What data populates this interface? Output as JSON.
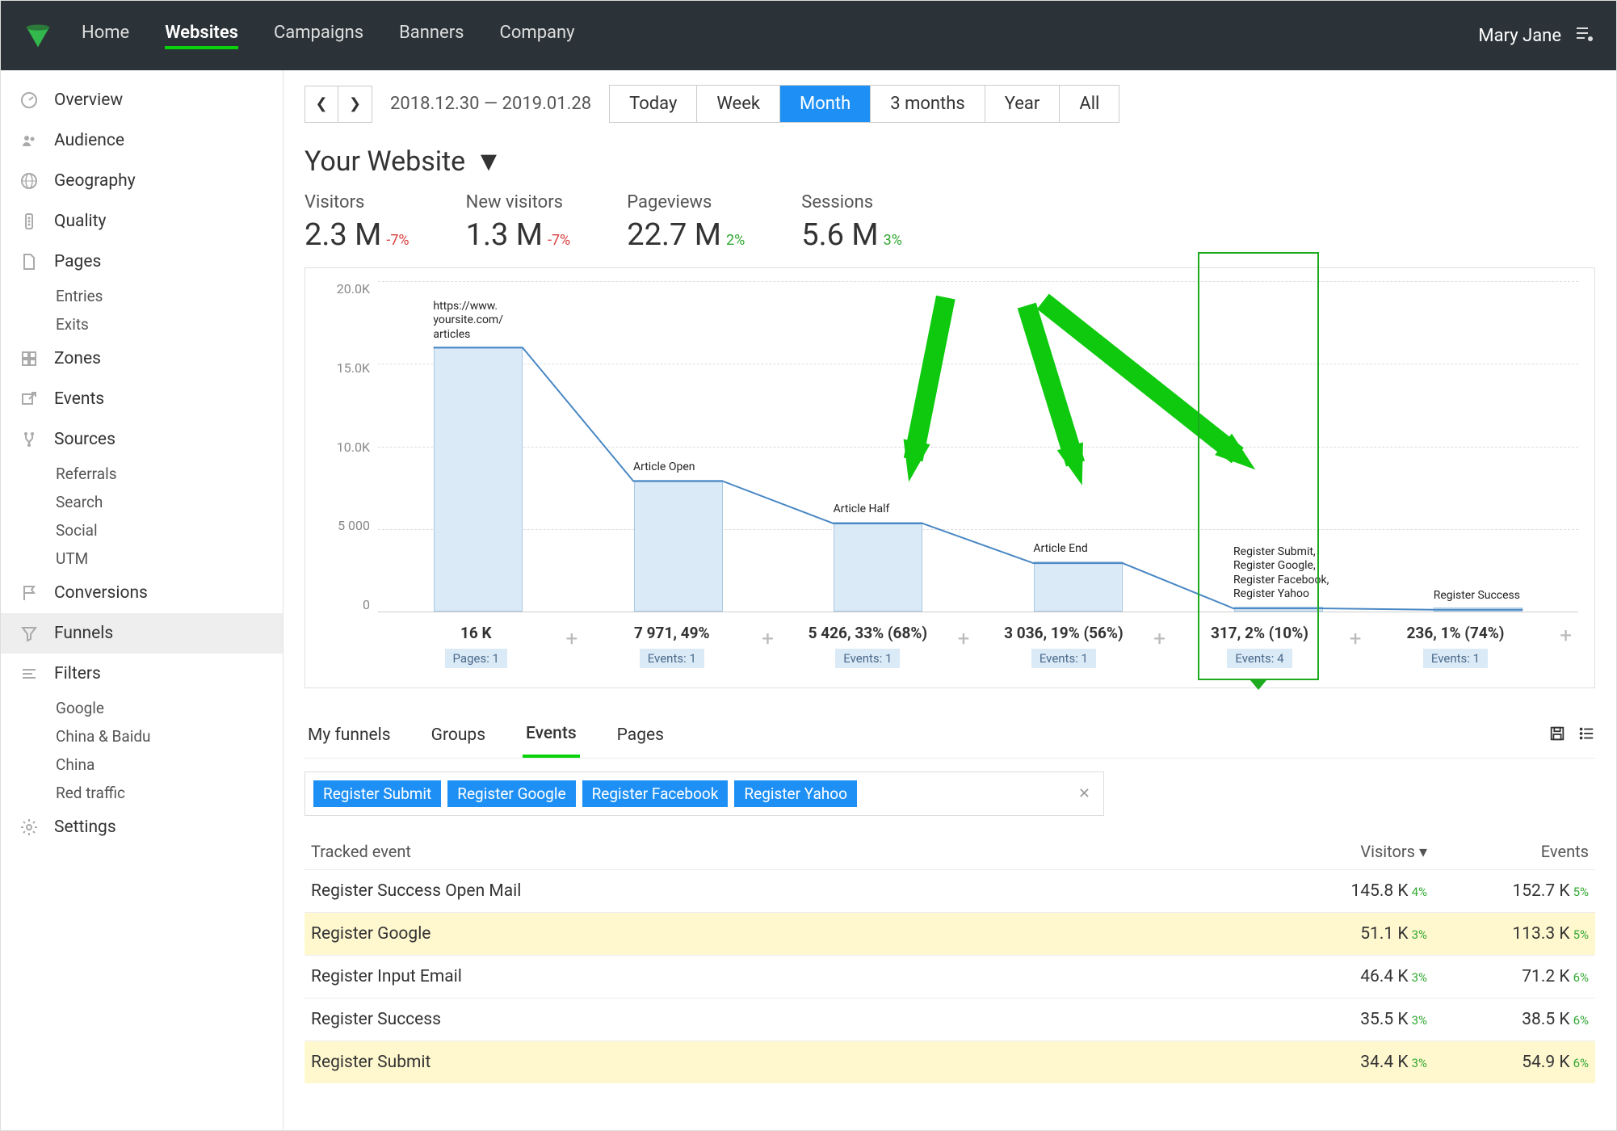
{
  "user_name": "Mary Jane",
  "topnav": [
    "Home",
    "Websites",
    "Campaigns",
    "Banners",
    "Company"
  ],
  "topnav_active": 1,
  "sidebar": [
    {
      "label": "Overview",
      "icon": "gauge"
    },
    {
      "label": "Audience",
      "icon": "people"
    },
    {
      "label": "Geography",
      "icon": "globe"
    },
    {
      "label": "Quality",
      "icon": "traffic"
    },
    {
      "label": "Pages",
      "icon": "file",
      "subs": [
        "Entries",
        "Exits"
      ]
    },
    {
      "label": "Zones",
      "icon": "grid"
    },
    {
      "label": "Events",
      "icon": "arrow-out"
    },
    {
      "label": "Sources",
      "icon": "branch",
      "subs": [
        "Referrals",
        "Search",
        "Social",
        "UTM"
      ]
    },
    {
      "label": "Conversions",
      "icon": "flag"
    },
    {
      "label": "Funnels",
      "icon": "funnel",
      "active": true
    },
    {
      "label": "Filters",
      "icon": "lines",
      "subs": [
        "Google",
        "China & Baidu",
        "China",
        "Red traffic"
      ]
    },
    {
      "label": "Settings",
      "icon": "gear"
    }
  ],
  "date_range": "2018.12.30  — 2019.01.28",
  "range_tabs": [
    "Today",
    "Week",
    "Month",
    "3 months",
    "Year",
    "All"
  ],
  "range_active": 2,
  "site_title": "Your Website",
  "stats": [
    {
      "label": "Visitors",
      "value": "2.3 M",
      "pct": "-7%",
      "dir": "neg"
    },
    {
      "label": "New visitors",
      "value": "1.3 M",
      "pct": "-7%",
      "dir": "neg"
    },
    {
      "label": "Pageviews",
      "value": "22.7 M",
      "pct": "2%",
      "dir": "pos"
    },
    {
      "label": "Sessions",
      "value": "5.6 M",
      "pct": "3%",
      "dir": "pos"
    }
  ],
  "chart_data": {
    "type": "bar",
    "y_ticks": [
      "20.0K",
      "15.0K",
      "10.0K",
      "5 000",
      "0"
    ],
    "y_max": 20000,
    "steps": [
      {
        "label": "https://www.\nyoursite.com/\narticles",
        "value": 16000,
        "summary": "16 K",
        "tag": "Pages: 1"
      },
      {
        "label": "Article Open",
        "value": 7971,
        "summary": "7 971, 49%",
        "tag": "Events: 1"
      },
      {
        "label": "Article Half",
        "value": 5426,
        "summary": "5 426, 33% (68%)",
        "tag": "Events: 1"
      },
      {
        "label": "Article End",
        "value": 3036,
        "summary": "3 036, 19% (56%)",
        "tag": "Events: 1"
      },
      {
        "label": "Register Submit,\nRegister Google,\nRegister Facebook,\nRegister Yahoo",
        "value": 317,
        "summary": "317, 2% (10%)",
        "tag": "Events: 4",
        "highlighted": true
      },
      {
        "label": "Register Success",
        "value": 236,
        "summary": "236, 1% (74%)",
        "tag": "Events: 1"
      }
    ]
  },
  "subtabs": [
    "My funnels",
    "Groups",
    "Events",
    "Pages"
  ],
  "subtab_active": 2,
  "filter_tags": [
    "Register Submit",
    "Register Google",
    "Register Facebook",
    "Register Yahoo"
  ],
  "table": {
    "headers": [
      "Tracked event",
      "Visitors",
      "Events"
    ],
    "sort_col": 1,
    "rows": [
      {
        "name": "Register Success Open Mail",
        "visitors": "145.8 K",
        "vp": "4%",
        "events": "152.7 K",
        "ep": "5%"
      },
      {
        "name": "Register Google",
        "visitors": "51.1 K",
        "vp": "3%",
        "events": "113.3 K",
        "ep": "5%",
        "hl": true
      },
      {
        "name": "Register Input Email",
        "visitors": "46.4 K",
        "vp": "3%",
        "events": "71.2 K",
        "ep": "6%"
      },
      {
        "name": "Register Success",
        "visitors": "35.5 K",
        "vp": "3%",
        "events": "38.5 K",
        "ep": "6%"
      },
      {
        "name": "Register Submit",
        "visitors": "34.4 K",
        "vp": "3%",
        "events": "54.9 K",
        "ep": "6%",
        "hl": true
      }
    ]
  }
}
